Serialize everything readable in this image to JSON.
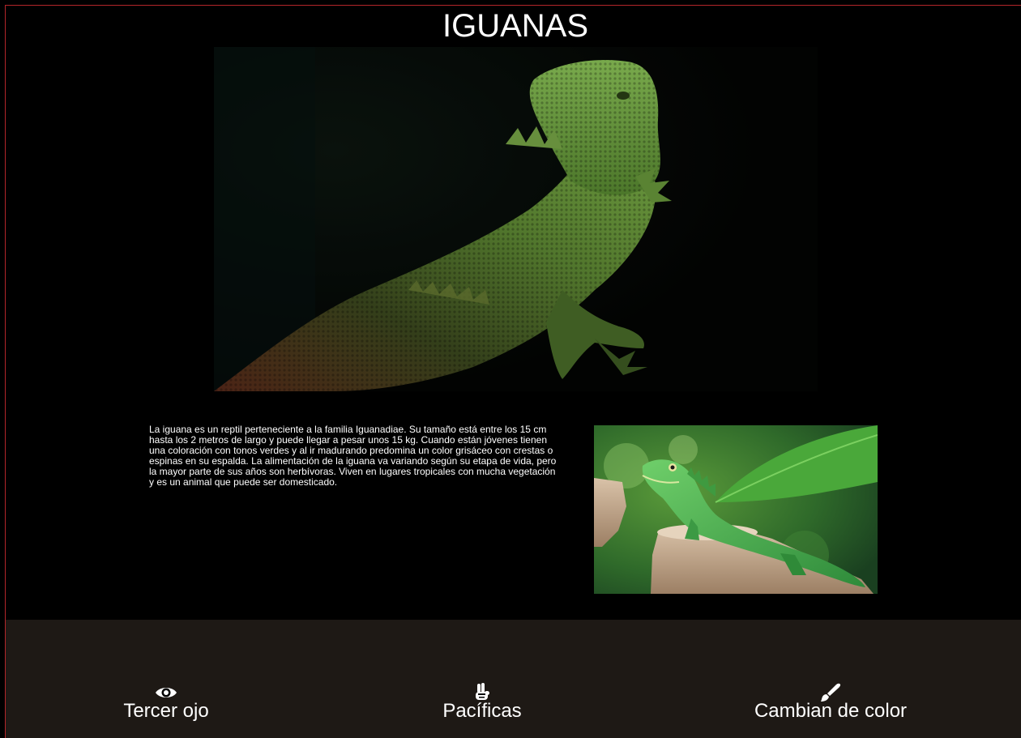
{
  "page": {
    "title": "IGUANAS"
  },
  "hero_image": {
    "subject": "bearded-dragon-photo"
  },
  "description": "La iguana es un reptil perteneciente a la familia Iguanadiae. Su tamaño está entre los 15 cm hasta los 2 metros de largo y puede llegar a pesar unos 15 kg. Cuando están jóvenes tienen una coloración con tonos verdes y al ir madurando predomina un color grisáceo con crestas o espinas en su espalda. La alimentación de la iguana va variando según su etapa de vida, pero la mayor parte de sus años son herbívoras. Viven en lugares tropicales con mucha vegetación y es un animal que puede ser domesticado.",
  "side_image": {
    "subject": "green-water-dragon-photo"
  },
  "footer": {
    "features": [
      {
        "icon": "eye-icon",
        "label": "Tercer ojo"
      },
      {
        "icon": "peace-hand-icon",
        "label": "Pacíficas"
      },
      {
        "icon": "paintbrush-icon",
        "label": "Cambian de color"
      }
    ]
  },
  "colors": {
    "background": "#000000",
    "footer_background": "#1e1915",
    "frame_border": "#b3262a",
    "text": "#ffffff"
  }
}
